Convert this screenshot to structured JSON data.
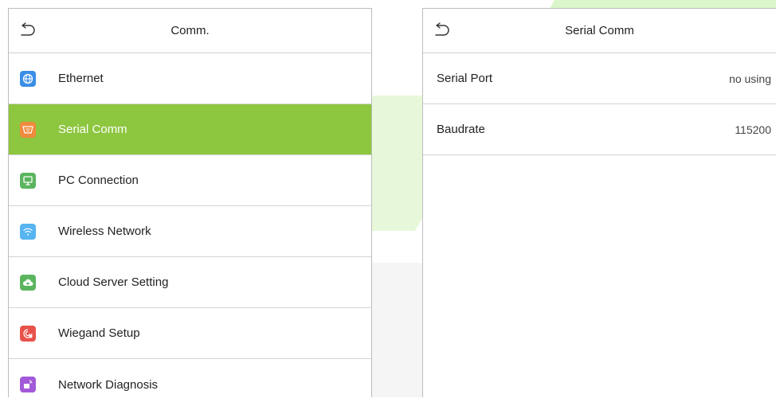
{
  "left": {
    "title": "Comm.",
    "items": [
      {
        "label": "Ethernet",
        "icon": "globe-icon",
        "color": "#3a8ee6"
      },
      {
        "label": "Serial Comm",
        "icon": "serial-port-icon",
        "color": "#f08a3c",
        "selected": true
      },
      {
        "label": "PC Connection",
        "icon": "monitor-icon",
        "color": "#5bb55e"
      },
      {
        "label": "Wireless Network",
        "icon": "wifi-icon",
        "color": "#56b4f0"
      },
      {
        "label": "Cloud Server Setting",
        "icon": "cloud-icon",
        "color": "#5bb55e"
      },
      {
        "label": "Wiegand Setup",
        "icon": "wiegand-icon",
        "color": "#e8524a"
      },
      {
        "label": "Network Diagnosis",
        "icon": "network-diagnosis-icon",
        "color": "#a25ad9"
      }
    ]
  },
  "right": {
    "title": "Serial Comm",
    "rows": [
      {
        "label": "Serial Port",
        "value": "no using"
      },
      {
        "label": "Baudrate",
        "value": "115200"
      }
    ]
  },
  "colors": {
    "accent": "#8dc63f"
  }
}
